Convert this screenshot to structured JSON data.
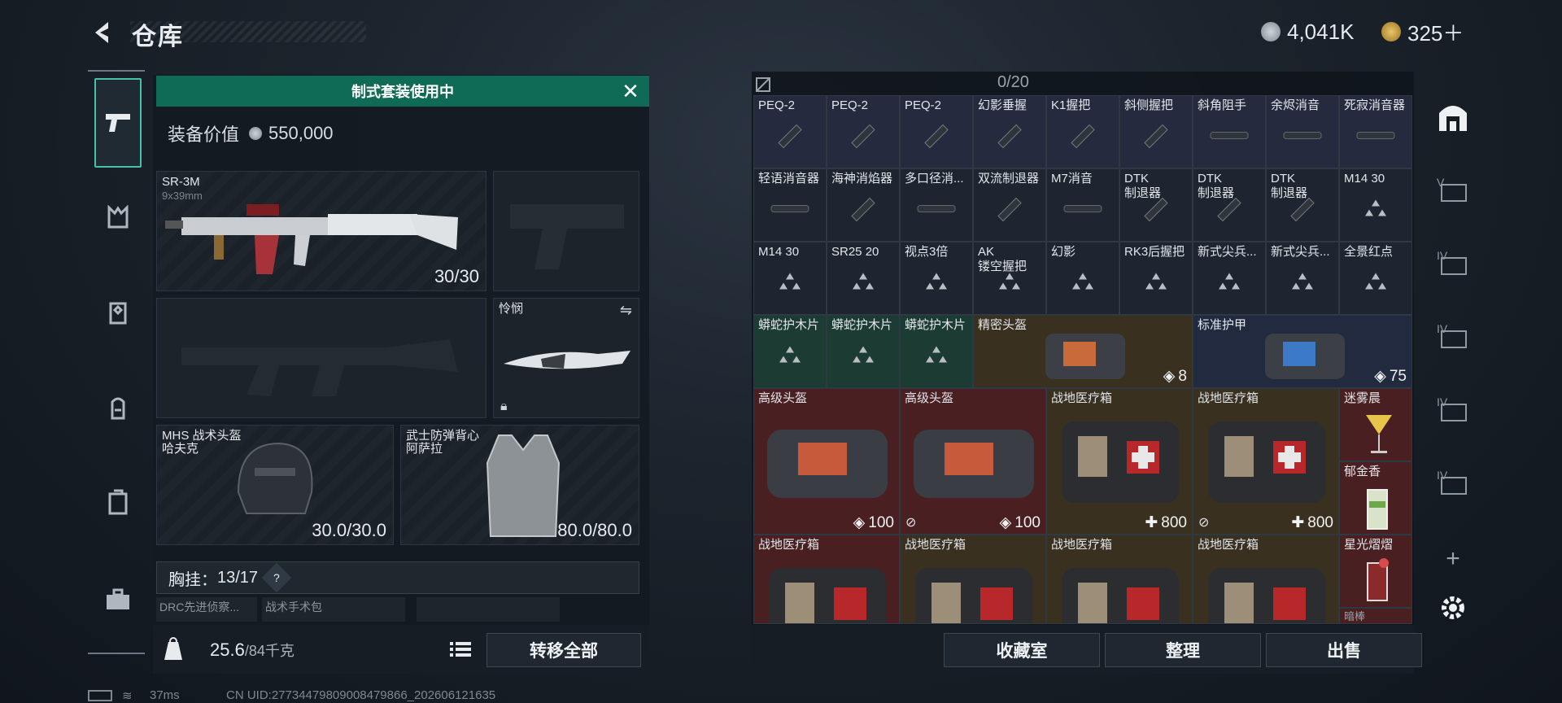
{
  "header": {
    "title": "仓库"
  },
  "currency": {
    "coins": "4,041K",
    "tickets": "325＋"
  },
  "left_panel": {
    "banner": "制式套装使用中",
    "equip_value_label": "装备价值",
    "equip_value": "550,000",
    "primary_weapon": {
      "name": "SR-3M",
      "caliber": "9x39mm",
      "ammo": "30/30"
    },
    "melee": {
      "name": "怜悯"
    },
    "helmet": {
      "name": "MHS 战术头盔",
      "sub": "哈夫克",
      "durability": "30.0/30.0"
    },
    "vest": {
      "name": "武士防弹背心",
      "sub": "阿萨拉",
      "durability": "80.0/80.0"
    },
    "chest_rig": {
      "label": "胸挂：",
      "value": "13/17",
      "help": "?"
    },
    "sub_items": [
      "DRC先进侦察...",
      "战术手术包"
    ],
    "weight": {
      "current": "25.6",
      "max": "/84千克"
    },
    "transfer_all": "转移全部"
  },
  "stash": {
    "capacity": "0/20",
    "rows": [
      [
        "PEQ-2",
        "PEQ-2",
        "PEQ-2",
        "幻影垂握",
        "K1握把",
        "斜侧握把",
        "斜角阻手",
        "余烬消音",
        "死寂消音器"
      ],
      [
        "轻语消音器",
        "海神消焰器",
        "多口径消...",
        "双流制退器",
        "M7消音",
        "DTK\n制退器",
        "DTK\n制退器",
        "DTK\n制退器",
        "M14 30"
      ],
      [
        "M14 30",
        "SR25 20",
        "视点3倍",
        "AK\n镂空握把",
        "幻影",
        "RK3后握把",
        "新式尖兵...",
        "新式尖兵...",
        "全景红点"
      ],
      [
        "蟒蛇护木片",
        "蟒蛇护木片",
        "蟒蛇护木片"
      ]
    ],
    "large_items": [
      {
        "name": "精密头盔",
        "value": "8"
      },
      {
        "name": "标准护甲",
        "value": "75"
      },
      {
        "name": "高级头盔",
        "value": "100"
      },
      {
        "name": "高级头盔",
        "value": "100"
      },
      {
        "name": "战地医疗箱",
        "value": "800"
      },
      {
        "name": "战地医疗箱",
        "value": "800"
      },
      {
        "name": "迷雾晨"
      },
      {
        "name": "郁金香"
      },
      {
        "name": "战地医疗箱"
      },
      {
        "name": "战地医疗箱"
      },
      {
        "name": "战地医疗箱"
      },
      {
        "name": "战地医疗箱"
      },
      {
        "name": "星光熠熠"
      },
      {
        "name": "暗棒"
      }
    ],
    "buttons": {
      "collection": "收藏室",
      "organize": "整理",
      "sell": "出售"
    }
  },
  "status_bar": {
    "ping": "37ms",
    "uid": "CN UID:27734479809008479866_202606121635"
  },
  "colors": {
    "accent_green": "#0f6b55",
    "tab_highlight": "#46c0a8",
    "rare_red": "#4a1f21",
    "gold_brown": "#3a3020"
  }
}
